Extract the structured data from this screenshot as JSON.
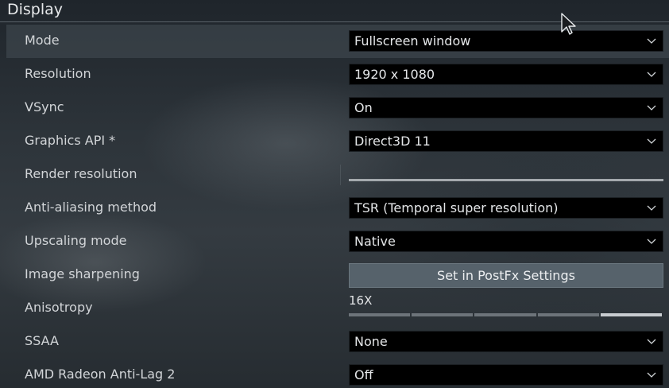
{
  "section": {
    "title": "Display"
  },
  "settings": [
    {
      "label": "Mode",
      "control": "select",
      "value": "Fullscreen window",
      "highlight": true
    },
    {
      "label": "Resolution",
      "control": "select",
      "value": "1920 x 1080"
    },
    {
      "label": "VSync",
      "control": "select",
      "value": "On"
    },
    {
      "label": "Graphics API *",
      "control": "select",
      "value": "Direct3D 11"
    },
    {
      "label": "Render resolution",
      "control": "slider"
    },
    {
      "label": "Anti-aliasing method",
      "control": "select",
      "value": "TSR (Temporal super resolution)"
    },
    {
      "label": "Upscaling mode",
      "control": "select",
      "value": "Native"
    },
    {
      "label": "Image sharpening",
      "control": "button",
      "value": "Set in PostFx Settings"
    },
    {
      "label": "Anisotropy",
      "control": "stepped-slider",
      "value": "16X",
      "level": 5,
      "steps": 5
    },
    {
      "label": "SSAA",
      "control": "select",
      "value": "None"
    },
    {
      "label": "AMD Radeon Anti-Lag 2",
      "control": "select",
      "value": "Off"
    }
  ],
  "icons": {
    "dropdown": "chevron-down-icon",
    "cursor": "mouse-pointer-icon"
  },
  "colors": {
    "select_bg": "#000000",
    "button_bg": "#56626b",
    "highlight_row": "#464e55"
  }
}
